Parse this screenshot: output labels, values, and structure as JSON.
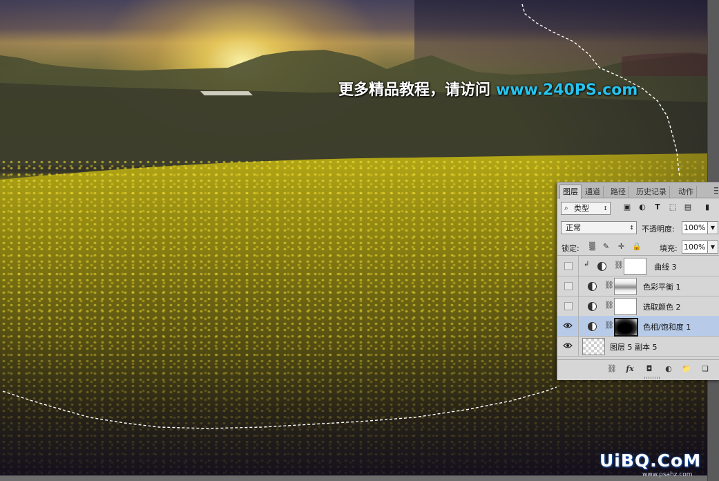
{
  "watermarks": {
    "top_text": "更多精品教程，请访问",
    "top_url": "www.240PS.com",
    "bottom_logo": "UiBQ.CoM",
    "bottom_sub": "www.psahz.com"
  },
  "layers_panel": {
    "tabs": [
      {
        "label": "图层",
        "active": true
      },
      {
        "label": "通道",
        "active": false
      },
      {
        "label": "路径",
        "active": false
      },
      {
        "label": "历史记录",
        "active": false
      },
      {
        "label": "动作",
        "active": false
      }
    ],
    "filter_label": "类型",
    "blend_mode": "正常",
    "opacity_label": "不透明度:",
    "opacity_value": "100%",
    "lock_label": "锁定:",
    "fill_label": "填充:",
    "fill_value": "100%",
    "layers": [
      {
        "name": "曲线 3",
        "visible": false,
        "selected": false,
        "clipped": true,
        "thumb": "white"
      },
      {
        "name": "色彩平衡 1",
        "visible": false,
        "selected": false,
        "clipped": false,
        "thumb": "noise"
      },
      {
        "name": "选取颜色 2",
        "visible": false,
        "selected": false,
        "clipped": false,
        "thumb": "white"
      },
      {
        "name": "色相/饱和度 1",
        "visible": true,
        "selected": true,
        "clipped": false,
        "thumb": "black-blob"
      },
      {
        "name": "图层 5 副本 5",
        "visible": true,
        "selected": false,
        "clipped": false,
        "thumb": "transparent"
      }
    ]
  },
  "colors": {
    "selected_layer": "#b7cbe9",
    "url_blue": "#27c4f0",
    "panel_bg": "#d6d6d6"
  }
}
